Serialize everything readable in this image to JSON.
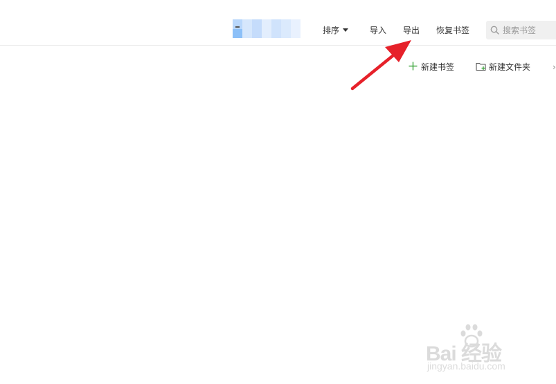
{
  "toolbar": {
    "sort_label": "排序",
    "import_label": "导入",
    "export_label": "导出",
    "restore_label": "恢复书签",
    "search_placeholder": "搜索书签"
  },
  "actions": {
    "new_bookmark_label": "新建书签",
    "new_folder_label": "新建文件夹",
    "more_glyph": "›"
  },
  "icons": {
    "sort_caret": "chevron-down-icon",
    "search": "search-icon",
    "new_bookmark": "plus-icon",
    "new_folder": "folder-add-icon"
  },
  "watermark": {
    "brand": "Bai  经验",
    "url": "jingyan.baidu.com"
  },
  "colors": {
    "accent_green": "#3aa53a",
    "annotation_arrow": "#e6212a",
    "text": "#333333",
    "search_bg": "#f0f0f0"
  }
}
